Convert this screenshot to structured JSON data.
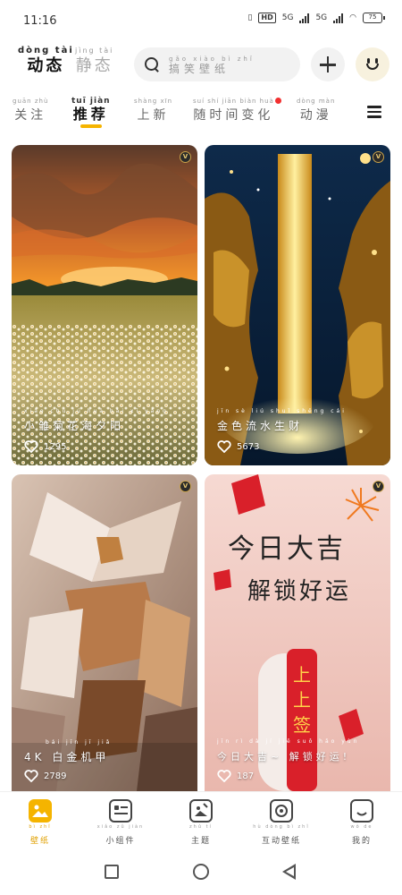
{
  "status_bar": {
    "time": "11:16",
    "hd_badge": "HD",
    "net_1": "5G",
    "net_2": "5G",
    "battery": "75"
  },
  "header": {
    "mode_tabs": [
      {
        "pinyin": "dòng tài",
        "label": "动态",
        "active": true
      },
      {
        "pinyin": "jìng tài",
        "label": "静态",
        "active": false
      }
    ],
    "search": {
      "pinyin": "gǎo xiào bì zhǐ",
      "placeholder": "搞笑壁纸"
    }
  },
  "categories": [
    {
      "pinyin": "guān zhù",
      "label": "关注",
      "active": false
    },
    {
      "pinyin": "tuī jiàn",
      "label": "推荐",
      "active": true
    },
    {
      "pinyin": "shàng xīn",
      "label": "上新",
      "active": false
    },
    {
      "pinyin": "suí shí jiān biàn huà",
      "label": "随时间变化",
      "active": false,
      "dot": true
    },
    {
      "pinyin": "dòng màn",
      "label": "动漫",
      "active": false
    }
  ],
  "cards": [
    {
      "pinyin": "xiǎo chú jú huā hǎi xī yáng",
      "title": "小雏菊花海夕阳",
      "likes": "1295",
      "badge": "V"
    },
    {
      "pinyin": "jīn sè liú shuǐ shēng cái",
      "title": "金色流水生财",
      "likes": "5673",
      "badge": "V"
    },
    {
      "pinyin": "bái jīn jī jiǎ",
      "title": "4K 白金机甲",
      "likes": "2789",
      "badge": "V",
      "art_text": []
    },
    {
      "pinyin": "jīn rì dà jí jiě suǒ hǎo yùn",
      "title": "今日大吉~ 解锁好运!",
      "likes": "187",
      "badge": "V",
      "art_text": [
        "今日大吉",
        "解锁好运",
        "上上签"
      ]
    }
  ],
  "bottom_nav": [
    {
      "pinyin": "bì zhǐ",
      "label": "壁纸",
      "icon": "wallpaper-icon",
      "active": true
    },
    {
      "pinyin": "xiǎo zǔ jiàn",
      "label": "小组件",
      "icon": "widget-icon",
      "active": false
    },
    {
      "pinyin": "zhǔ tí",
      "label": "主题",
      "icon": "theme-icon",
      "active": false
    },
    {
      "pinyin": "hù dòng bì zhǐ",
      "label": "互动壁纸",
      "icon": "interactive-wallpaper-icon",
      "active": false
    },
    {
      "pinyin": "wǒ de",
      "label": "我的",
      "icon": "profile-icon",
      "active": false
    }
  ],
  "colors": {
    "accent": "#f5b400",
    "dot": "#f23030"
  }
}
